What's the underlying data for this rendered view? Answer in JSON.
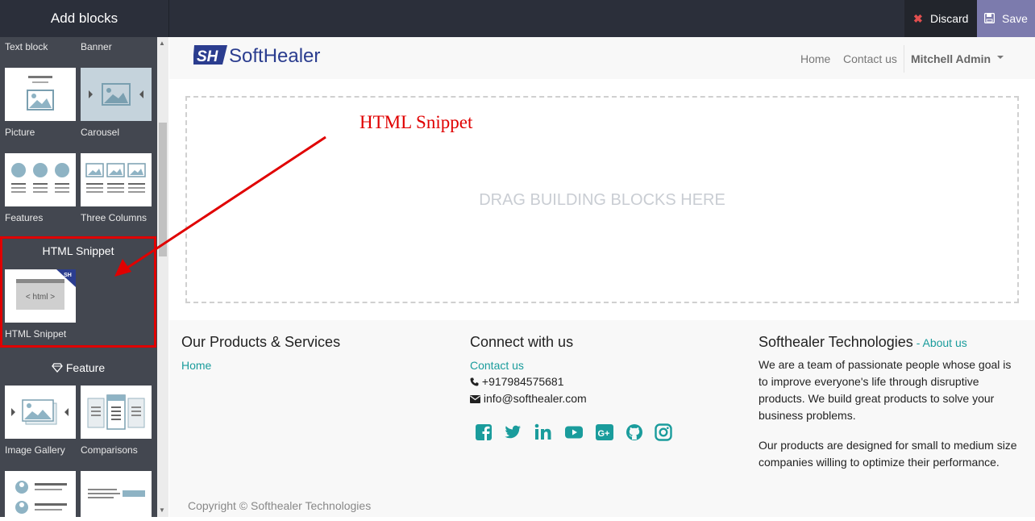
{
  "topbar": {
    "sidebar_title": "Add blocks",
    "discard_label": "Discard",
    "save_label": "Save"
  },
  "sidebar": {
    "blocks": [
      {
        "label": "Text block"
      },
      {
        "label": "Banner"
      },
      {
        "label": "Picture"
      },
      {
        "label": "Carousel"
      },
      {
        "label": "Features"
      },
      {
        "label": "Three Columns"
      },
      {
        "label": "HTML Snippet"
      },
      {
        "label": "Image Gallery"
      },
      {
        "label": "Comparisons"
      }
    ],
    "highlight_section_title": "HTML Snippet",
    "snippet_thumb_text": "< html >",
    "feature_section_title": "Feature"
  },
  "navbar": {
    "logo_text": "SoftHealer",
    "home": "Home",
    "contact": "Contact us",
    "user": "Mitchell Admin"
  },
  "main": {
    "drop_text": "DRAG BUILDING BLOCKS HERE",
    "annotation": "HTML Snippet"
  },
  "footer": {
    "col1_title": "Our Products & Services",
    "col1_link": "Home",
    "col2_title": "Connect with us",
    "col2_link": "Contact us",
    "phone": "+917984575681",
    "email": "info@softhealer.com",
    "col3_title": "Softhealer Technologies",
    "col3_sep": " - ",
    "col3_link": "About us",
    "about_p1": "We are a team of passionate people whose goal is to improve everyone's life through disruptive products. We build great products to solve your business problems.",
    "about_p2": "Our products are designed for small to medium size companies willing to optimize their performance.",
    "copyright": "Copyright © Softhealer Technologies"
  },
  "colors": {
    "accent": "#1a9c9c",
    "save_bg": "#7c7bad",
    "annotation": "#e00000"
  },
  "icons": [
    "close-icon",
    "save-icon",
    "facebook-icon",
    "twitter-icon",
    "linkedin-icon",
    "youtube-icon",
    "google-plus-icon",
    "github-icon",
    "instagram-icon",
    "phone-icon",
    "envelope-icon",
    "diamond-icon"
  ]
}
